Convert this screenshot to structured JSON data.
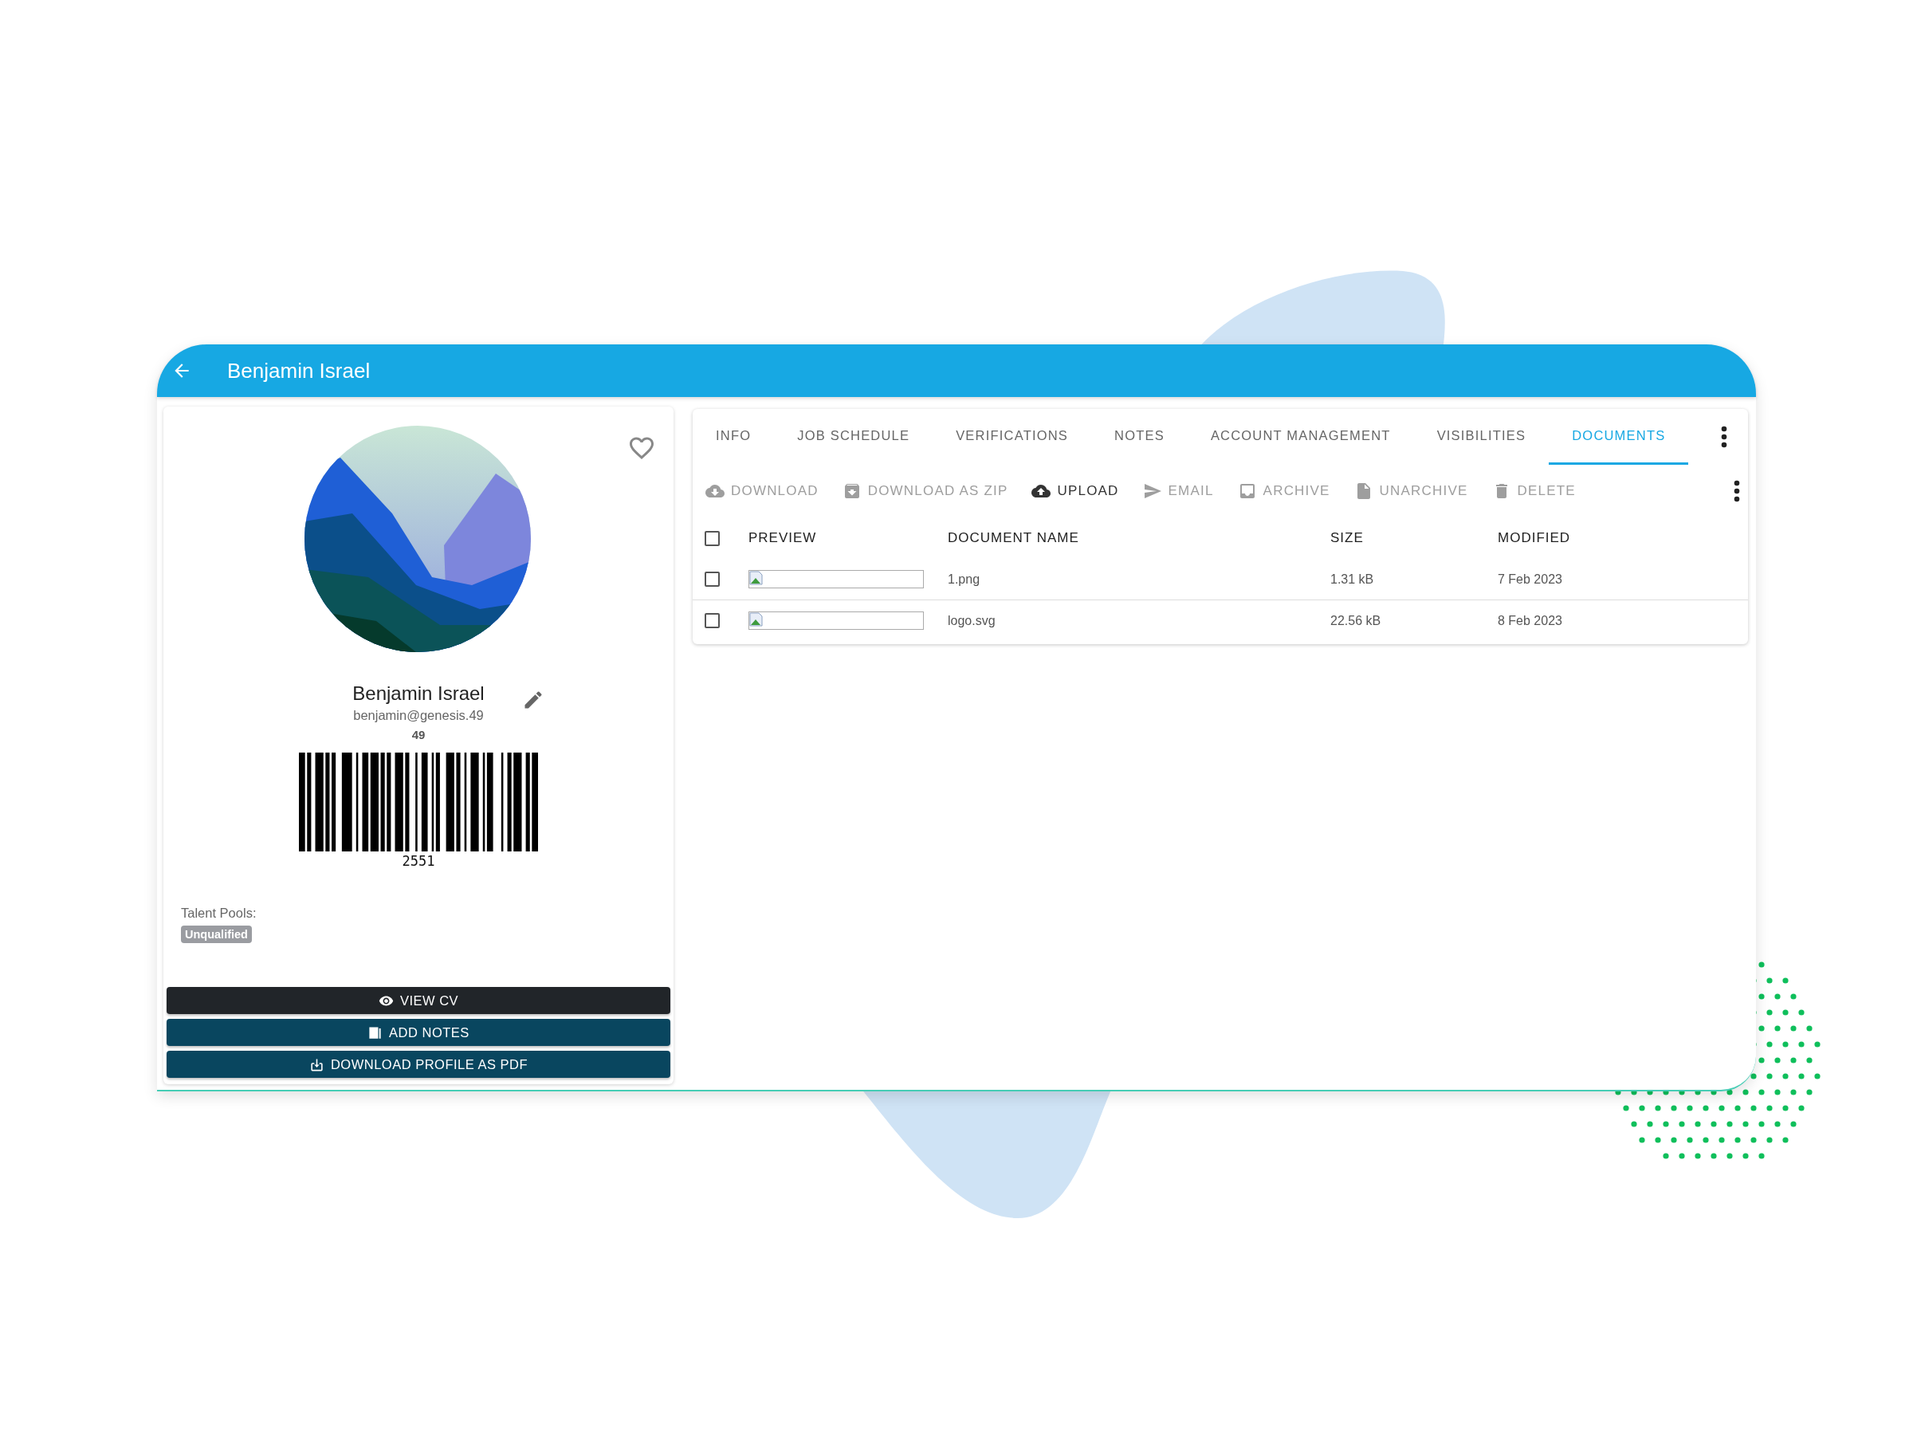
{
  "header": {
    "title": "Benjamin Israel"
  },
  "profile": {
    "name": "Benjamin Israel",
    "email": "benjamin@genesis.49",
    "number": "49",
    "favorite": false,
    "barcode_number": "2551",
    "talent_pools_label": "Talent Pools:",
    "talent_pools": [
      "Unqualified"
    ]
  },
  "profile_buttons": [
    {
      "label": "VIEW CV",
      "kind": "view"
    },
    {
      "label": "ADD NOTES",
      "kind": "notes"
    },
    {
      "label": "DOWNLOAD PROFILE AS PDF",
      "kind": "pdf"
    }
  ],
  "tabs": [
    {
      "label": "INFO",
      "selected": false
    },
    {
      "label": "JOB SCHEDULE",
      "selected": false
    },
    {
      "label": "VERIFICATIONS",
      "selected": false
    },
    {
      "label": "NOTES",
      "selected": false
    },
    {
      "label": "ACCOUNT MANAGEMENT",
      "selected": false
    },
    {
      "label": "VISIBILITIES",
      "selected": false
    },
    {
      "label": "DOCUMENTS",
      "selected": true
    }
  ],
  "toolbar": [
    {
      "label": "DOWNLOAD",
      "kind": "cloud-download",
      "disabled": true
    },
    {
      "label": "DOWNLOAD AS ZIP",
      "kind": "zip",
      "disabled": true
    },
    {
      "label": "UPLOAD",
      "kind": "cloud-upload",
      "disabled": false
    },
    {
      "label": "EMAIL",
      "kind": "send",
      "disabled": true
    },
    {
      "label": "ARCHIVE",
      "kind": "inbox",
      "disabled": true
    },
    {
      "label": "UNARCHIVE",
      "kind": "file",
      "disabled": true
    },
    {
      "label": "DELETE",
      "kind": "trash",
      "disabled": true
    }
  ],
  "table": {
    "columns": [
      "PREVIEW",
      "DOCUMENT NAME",
      "SIZE",
      "MODIFIED"
    ],
    "all_checked": false,
    "rows": [
      {
        "checked": false,
        "name": "1.png",
        "size": "1.31 kB",
        "modified": "7 Feb 2023"
      },
      {
        "checked": false,
        "name": "logo.svg",
        "size": "22.56 kB",
        "modified": "8 Feb 2023"
      }
    ]
  }
}
